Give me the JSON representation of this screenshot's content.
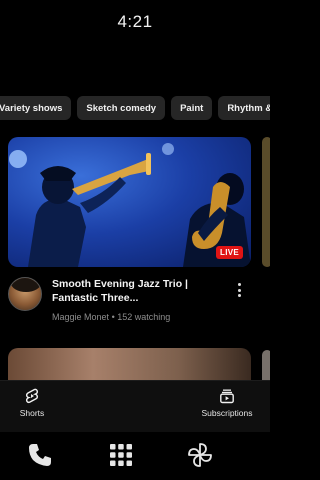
{
  "status_bar": {
    "time": "4:21"
  },
  "filter_chips": [
    "Variety shows",
    "Sketch comedy",
    "Paint",
    "Rhythm & B"
  ],
  "video": {
    "title": "Smooth Evening Jazz Trio | Fantastic Three...",
    "channel": "Maggie Monet",
    "watching": "152 watching",
    "badge": "LIVE"
  },
  "bottom_nav": {
    "shorts_label": "Shorts",
    "subscriptions_label": "Subscriptions"
  },
  "dock_icons": [
    "phone-icon",
    "app-grid-icon",
    "pinwheel-icon"
  ],
  "colors": {
    "live_red": "#e01414",
    "background": "#000000",
    "chip_bg": "#262626"
  }
}
